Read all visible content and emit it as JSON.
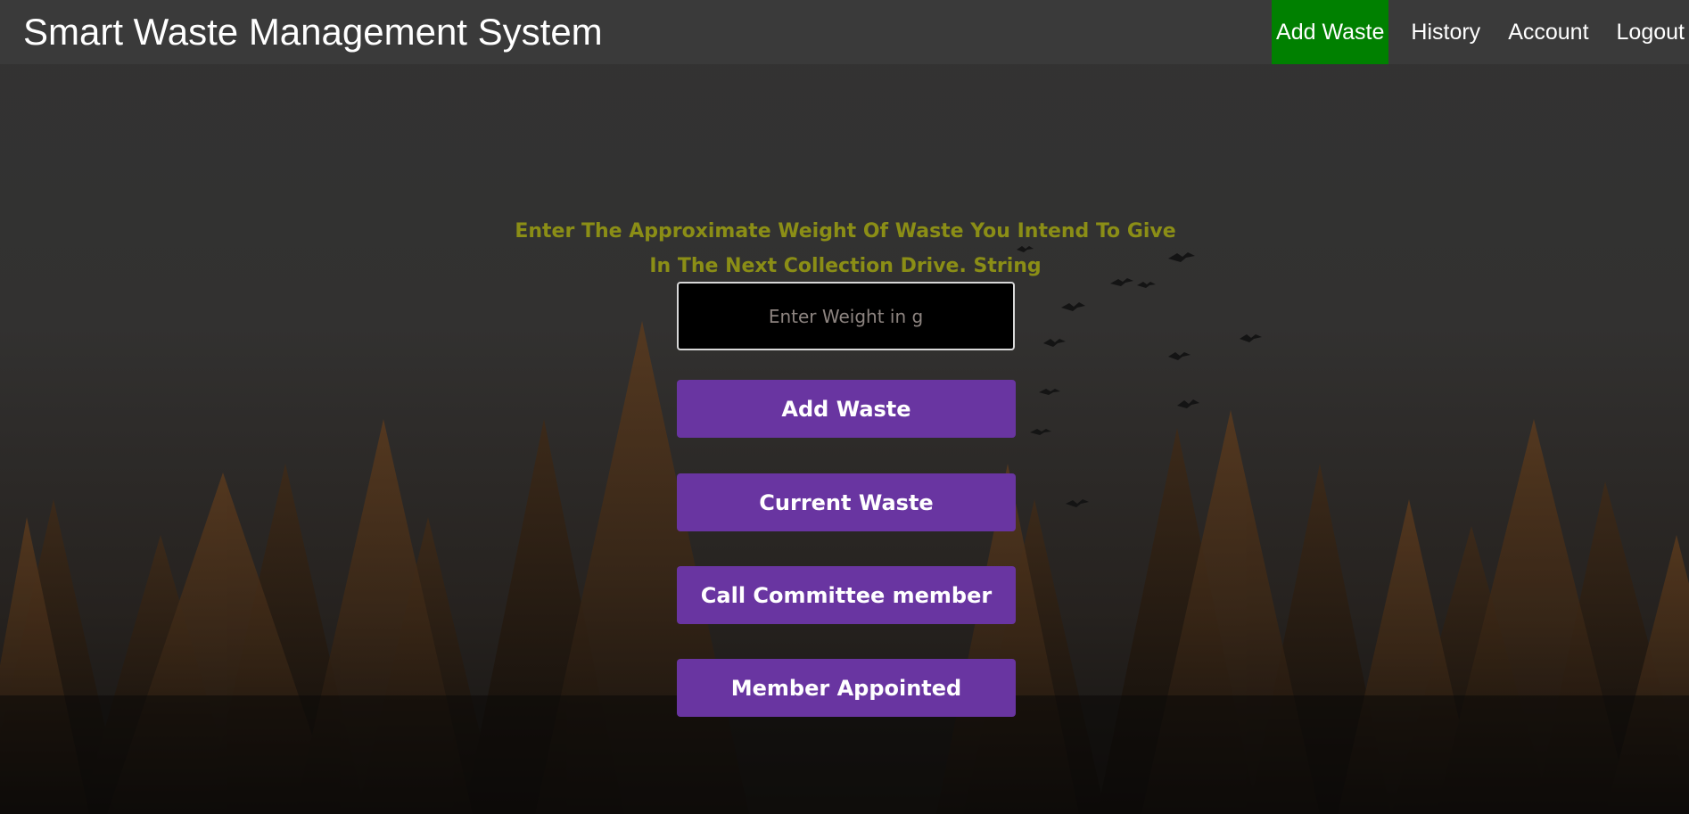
{
  "header": {
    "title": "Smart Waste Management System",
    "nav": [
      {
        "label": "Add Waste",
        "active": true
      },
      {
        "label": "History",
        "active": false
      },
      {
        "label": "Account",
        "active": false
      },
      {
        "label": "Logout",
        "active": false
      }
    ]
  },
  "main": {
    "prompt_line1": "Enter The Approximate Weight Of Waste You Intend To Give",
    "prompt_line2": "In The Next Collection Drive. String",
    "weight_input": {
      "value": "",
      "placeholder": "Enter Weight in g"
    },
    "buttons": {
      "add_waste": "Add Waste",
      "current_waste": "Current Waste",
      "call_committee": "Call Committee member",
      "member_appointed": "Member Appointed"
    }
  },
  "colors": {
    "nav_active": "#008000",
    "header_bg": "#3a3a3a",
    "button_bg": "#6935a1",
    "prompt_text": "#8b8e16"
  }
}
